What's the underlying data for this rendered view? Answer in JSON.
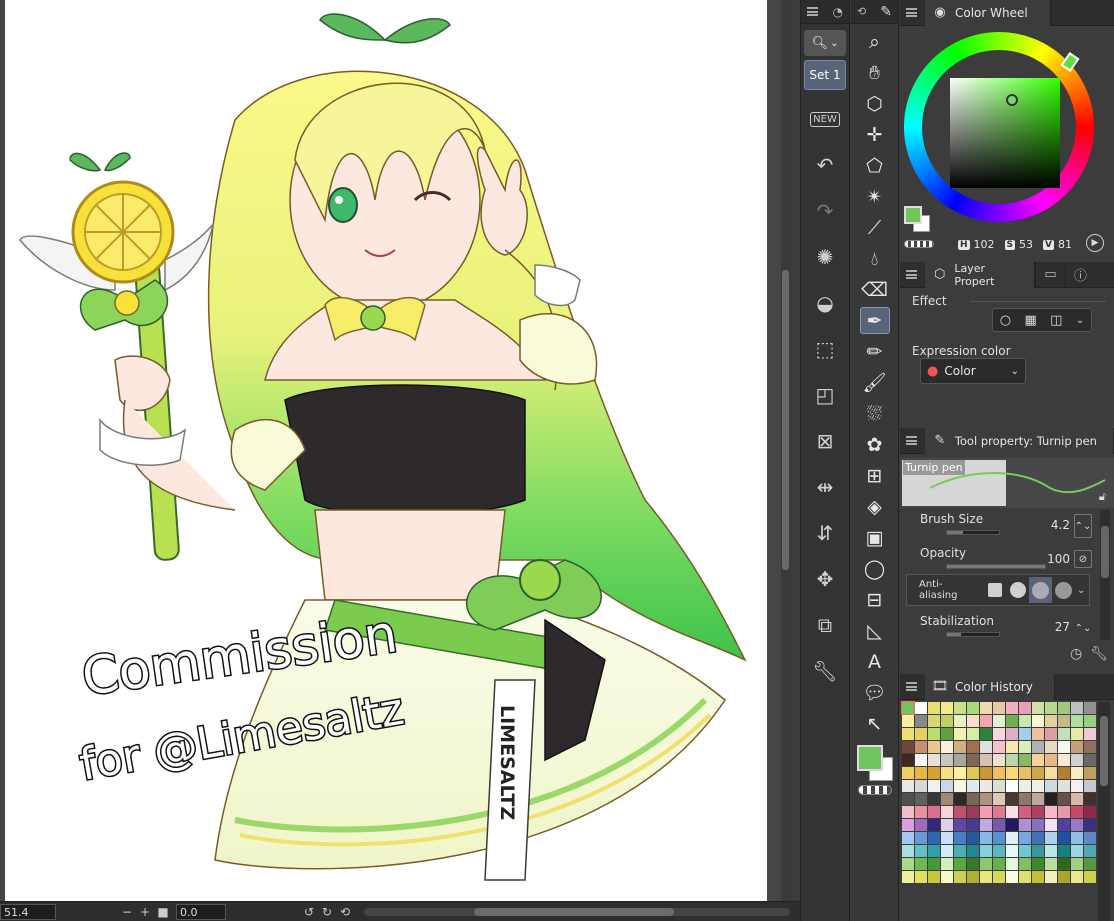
{
  "subtool": {
    "set_label": "Set 1",
    "icons": [
      "new-badge-icon",
      "undo-icon",
      "redo-icon",
      "loading-icon",
      "fill-icon",
      "transform-icon",
      "mesh-icon",
      "flip-horizontal-icon",
      "flip-vertical-icon",
      "rotate-icon",
      "screenshot-icon",
      "wrench-icon"
    ]
  },
  "canvas": {
    "watermark_line1": "Commission",
    "watermark_line2": "for @Limesaltz",
    "sash_text": "LIMESALTZ"
  },
  "status": {
    "zoom": "51.4",
    "rotation": "0.0"
  },
  "color_wheel": {
    "tab_label": "Color Wheel",
    "h_label": "H",
    "h_value": "102",
    "s_label": "S",
    "s_value": "53",
    "v_label": "V",
    "v_value": "81",
    "main_color": "#72c55a",
    "sub_color": "#ffffff"
  },
  "layer_property": {
    "tab_label": "Layer Propert",
    "effect_label": "Effect",
    "expression_label": "Expression color",
    "expression_value": "Color"
  },
  "tool_property": {
    "tab_label": "Tool property: Turnip pen",
    "preview_name": "Turnip pen",
    "brush_size_label": "Brush Size",
    "brush_size_value": "4.2",
    "opacity_label": "Opacity",
    "opacity_value": "100",
    "antialias_label": "Anti-aliasing",
    "stabilization_label": "Stabilization",
    "stabilization_value": "27"
  },
  "color_history": {
    "tab_label": "Color History",
    "colors": [
      "#72c55a",
      "#ffffff",
      "#e8e070",
      "#f4e88a",
      "#c8e088",
      "#a8d878",
      "#f0d8b0",
      "#e8c8a0",
      "#f0b0c0",
      "#e8a0b8",
      "#d0e0a0",
      "#b8d890",
      "#a0c880",
      "#c0c0c0",
      "#909090",
      "#f8f0a0",
      "#888888",
      "#d8d870",
      "#c0d060",
      "#e8f0c0",
      "#f8e0c8",
      "#f0a8a8",
      "#e0f0d0",
      "#70b050",
      "#c8e8b0",
      "#f8f8d0",
      "#e0d0a0",
      "#c8b888",
      "#b0e0a0",
      "#98d080",
      "#f0e070",
      "#e8d060",
      "#b8e070",
      "#60a040",
      "#f0f0b0",
      "#d0f0a0",
      "#308040",
      "#f8d8e0",
      "#e0b0c0",
      "#a0d0f0",
      "#f0c0a0",
      "#d8a0a0",
      "#c0e0c0",
      "#e8e8a8",
      "#f0c8d8",
      "#704838",
      "#c89070",
      "#e8c890",
      "#f8f0e0",
      "#d0b080",
      "#a07050",
      "#e0e0e0",
      "#f8c0c8",
      "#f8e8b0",
      "#d8f0b8",
      "#b0b0b0",
      "#e8d8c8",
      "#f0f8f0",
      "#c8a078",
      "#907060",
      "#402820",
      "#f8f8f8",
      "#e8e0d8",
      "#c8c8c0",
      "#a8a8a0",
      "#806858",
      "#d8c0b0",
      "#f0e0d0",
      "#b8d8a8",
      "#88b868",
      "#f8d098",
      "#e8b888",
      "#f8e8d8",
      "#d0d0d0",
      "#686868",
      "#f0d060",
      "#e8b840",
      "#d8a030",
      "#f8e080",
      "#fff0a0",
      "#e0c850",
      "#c89838",
      "#f0c060",
      "#f8d878",
      "#e8c068",
      "#d0a848",
      "#f0e0a0",
      "#b08030",
      "#f8f0c0",
      "#c0a060",
      "#e8e8e8",
      "#d8d8d8",
      "#f0f0f0",
      "#c8d8e8",
      "#f8f8e0",
      "#e0e8f0",
      "#f0e8e0",
      "#d8e0d0",
      "#ffffff",
      "#e8f0e8",
      "#f0f0e8",
      "#d0d8e0",
      "#e0e0d8",
      "#f8f0f0",
      "#c8c8d0",
      "#505050",
      "#606060",
      "#383838",
      "#a08878",
      "#302828",
      "#786858",
      "#b09080",
      "#e0c8b8",
      "#483830",
      "#907868",
      "#c0a898",
      "#282020",
      "#685048",
      "#d8b8a8",
      "#403030",
      "#f0c0c8",
      "#e890a0",
      "#d87090",
      "#f8d0d8",
      "#c05070",
      "#a03858",
      "#f0a0b0",
      "#e07890",
      "#f8e0e8",
      "#d06080",
      "#b04060",
      "#f8b8c8",
      "#e898a8",
      "#c84868",
      "#902848",
      "#d8a0e0",
      "#a068c0",
      "#302878",
      "#e0d0f0",
      "#6048a0",
      "#483890",
      "#c0a8e0",
      "#7858b0",
      "#201860",
      "#b090d0",
      "#8870c0",
      "#f0e0f8",
      "#5040a0",
      "#9878c8",
      "#383080",
      "#a0c8f0",
      "#6898d8",
      "#3068b0",
      "#c8e0f8",
      "#4880c8",
      "#2858a0",
      "#88b8e8",
      "#5890d0",
      "#e0f0f8",
      "#78a8e0",
      "#4070b8",
      "#b0d0f0",
      "#2050a0",
      "#90c0e8",
      "#6088c8",
      "#a8e0e0",
      "#60c0c8",
      "#30a0a8",
      "#d0f0f0",
      "#48b0b8",
      "#208890",
      "#88d0d8",
      "#58b8c0",
      "#e8f8f8",
      "#70c8d0",
      "#389898",
      "#b8e8e8",
      "#188080",
      "#98d8e0",
      "#50a8b0",
      "#a8d888",
      "#70b850",
      "#489838",
      "#d0f0c0",
      "#58a840",
      "#387828",
      "#90c870",
      "#68b048",
      "#e8f8e0",
      "#80c060",
      "#408830",
      "#b8e0a0",
      "#306820",
      "#a0d080",
      "#589840",
      "#f0f0a0",
      "#e0e060",
      "#c8c840",
      "#f8f8c8",
      "#d0d050",
      "#b0b030",
      "#e8e880",
      "#d8d858",
      "#fcfce0",
      "#e0e070",
      "#c0c038",
      "#f0f0b8",
      "#a8a828",
      "#e8e890",
      "#d0d048"
    ]
  }
}
